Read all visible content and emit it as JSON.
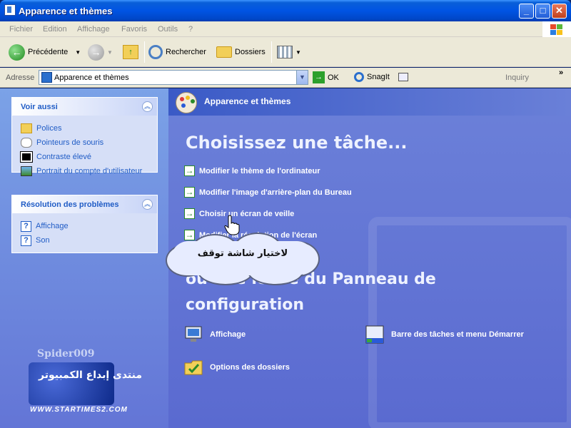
{
  "window": {
    "title": "Apparence et thèmes",
    "buttons": {
      "minimize": "_",
      "maximize": "□",
      "close": "✕"
    }
  },
  "menubar": {
    "items": [
      "Fichier",
      "Edition",
      "Affichage",
      "Favoris",
      "Outils",
      "?"
    ]
  },
  "toolbar": {
    "back_label": "Précédente",
    "search_label": "Rechercher",
    "folders_label": "Dossiers"
  },
  "addressbar": {
    "label": "Adresse",
    "value": "Apparence et thèmes",
    "go_label": "OK",
    "snagit_label": "SnagIt",
    "inquiry_label": "Inquiry",
    "more": "»"
  },
  "sidebar": {
    "see_also": {
      "title": "Voir aussi",
      "items": [
        {
          "label": "Polices",
          "icon": "fonts-folder-icon"
        },
        {
          "label": "Pointeurs de souris",
          "icon": "mouse-pointer-icon"
        },
        {
          "label": "Contraste élevé",
          "icon": "high-contrast-icon"
        },
        {
          "label": "Portrait du compte d'utilisateur",
          "icon": "user-picture-icon"
        }
      ]
    },
    "troubleshoot": {
      "title": "Résolution des problèmes",
      "items": [
        {
          "label": "Affichage",
          "icon": "help-icon"
        },
        {
          "label": "Son",
          "icon": "help-icon"
        }
      ]
    }
  },
  "main": {
    "header_title": "Apparence et thèmes",
    "choose_task_heading": "Choisissez une tâche...",
    "tasks": [
      "Modifier le thème de l'ordinateur",
      "Modifier l'image d'arrière-plan du Bureau",
      "Choisir un écran de veille",
      "Modifier la résolution de l'écran"
    ],
    "or_heading_line1": "ou une icône du Panneau de",
    "or_heading_line2": "configuration",
    "cp_icons": [
      {
        "label": "Affichage",
        "icon": "display-icon"
      },
      {
        "label": "Barre des tâches et menu Démarrer",
        "icon": "taskbar-icon"
      },
      {
        "label": "Options des dossiers",
        "icon": "folder-options-icon"
      }
    ]
  },
  "callout": {
    "text": "لاختيار شاشة توقف"
  },
  "watermark": {
    "name": "Spider009",
    "arabic": "منتدى إبداع الكمبيوتر",
    "url": "WWW.STARTIMES2.COM"
  },
  "colors": {
    "titlebar": "#0054e3",
    "left_panel": "#6f8ce0",
    "right_panel": "#6375d6",
    "link": "#215dc6"
  }
}
